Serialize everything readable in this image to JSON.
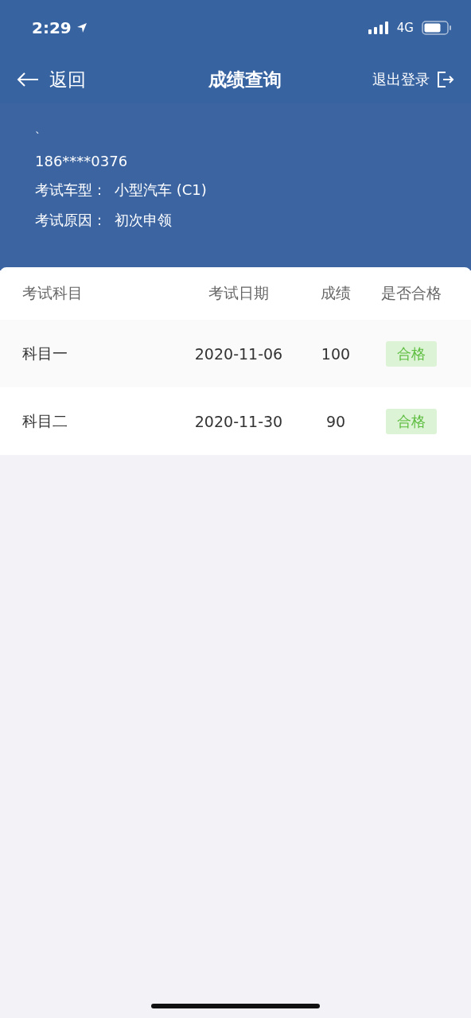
{
  "status_bar": {
    "time": "2:29",
    "network": "4G"
  },
  "nav": {
    "back": "返回",
    "title": "成绩查询",
    "logout": "退出登录"
  },
  "profile": {
    "name": "`",
    "phone": "186****0376",
    "fields": [
      {
        "label": "考试车型：",
        "value": "小型汽车 (C1)"
      },
      {
        "label": "考试原因：",
        "value": "初次申领"
      }
    ]
  },
  "table": {
    "columns": [
      "考试科目",
      "考试日期",
      "成绩",
      "是否合格"
    ],
    "rows": [
      {
        "subject": "科目一",
        "date": "2020-11-06",
        "score": "100",
        "result": "合格",
        "passed": true
      },
      {
        "subject": "科目二",
        "date": "2020-11-30",
        "score": "90",
        "result": "合格",
        "passed": true
      }
    ]
  }
}
